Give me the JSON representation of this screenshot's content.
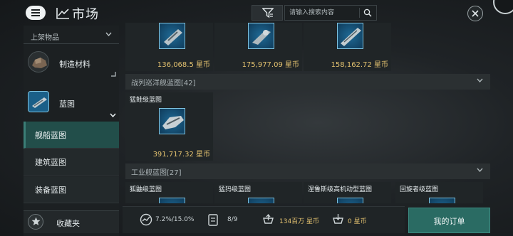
{
  "header": {
    "title": "市场",
    "search_placeholder": "请输入搜索内容"
  },
  "sidebar": {
    "listing_header": "上架物品",
    "categories": [
      {
        "label": "制造材料"
      },
      {
        "label": "蓝图"
      }
    ],
    "subcategories": [
      {
        "label": "舰船蓝图",
        "selected": true
      },
      {
        "label": "建筑蓝图",
        "selected": false
      },
      {
        "label": "装备蓝图",
        "selected": false
      }
    ],
    "favorites_label": "收藏夹"
  },
  "main": {
    "top_row": [
      {
        "price": "136,068.5 星币"
      },
      {
        "price": "175,977.09 星币"
      },
      {
        "price": "158,162.72 星币"
      }
    ],
    "sections": [
      {
        "title": "战列巡洋舰蓝图[42]",
        "items": [
          {
            "name": "猛鲑级蓝图",
            "price": "391,717.32 星币"
          }
        ]
      },
      {
        "title": "工业舰蓝图[27]",
        "items": [
          {
            "name": "狐鼬级蓝图"
          },
          {
            "name": "猛犸级蓝图"
          },
          {
            "name": "涅鲁斯级高机动型蓝图"
          },
          {
            "name": "回旋者级蓝图"
          }
        ]
      }
    ]
  },
  "bottom_bar": {
    "tax": "7.2%/15.0%",
    "orders_count": "8/9",
    "isk_balance": "134百万 星币",
    "escrow": "0 星币",
    "my_orders_button": "我的订单"
  },
  "colors": {
    "accent_teal": "#224e4a",
    "price_gold": "#e2c16f",
    "orders_button": "#2a6b63"
  },
  "icons": [
    "menu-icon",
    "chart-icon",
    "filter-icon",
    "search-icon",
    "close-icon",
    "chevron-down-icon",
    "star-icon",
    "gauge-icon",
    "clipboard-icon",
    "cart-up-icon",
    "cart-down-icon"
  ]
}
